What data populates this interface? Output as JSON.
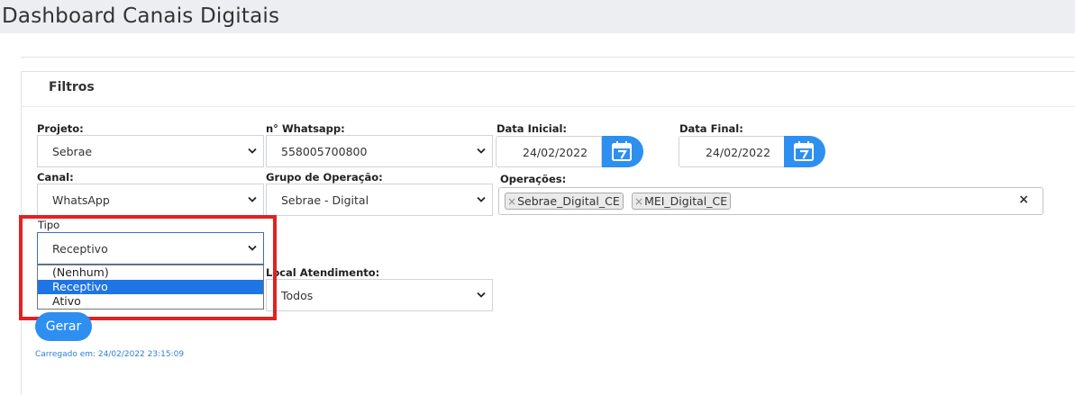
{
  "page": {
    "title": "Dashboard Canais Digitais"
  },
  "filters": {
    "title": "Filtros",
    "projeto": {
      "label": "Projeto:",
      "value": "Sebrae"
    },
    "whatsapp": {
      "label": "n° Whatsapp:",
      "value": "558005700800"
    },
    "data_inicial": {
      "label": "Data Inicial:",
      "value": "24/02/2022",
      "icon": "calendar-icon"
    },
    "data_final": {
      "label": "Data Final:",
      "value": "24/02/2022",
      "icon": "calendar-icon"
    },
    "canal": {
      "label": "Canal:",
      "value": "WhatsApp"
    },
    "grupo_operacao": {
      "label": "Grupo de Operação:",
      "value": "Sebrae - Digital"
    },
    "operacoes": {
      "label": "Operações:",
      "tags": [
        "Sebrae_Digital_CE",
        "MEI_Digital_CE"
      ],
      "remove_glyph": "×",
      "clear_glyph": "×"
    },
    "tipo": {
      "label": "Tipo",
      "value": "Receptivo",
      "options": [
        "(Nenhum)",
        "Receptivo",
        "Ativo"
      ],
      "selected_index": 1
    },
    "local_atendimento": {
      "label": "Local Atendimento:",
      "value": "Todos"
    }
  },
  "actions": {
    "gerar_label": "Gerar"
  },
  "status": {
    "loaded_text": "Carregado em: 24/02/2022 23:15:09"
  },
  "colors": {
    "accent": "#2d8ff0",
    "highlight_box": "#e32121",
    "selected_option": "#1e75e6"
  }
}
